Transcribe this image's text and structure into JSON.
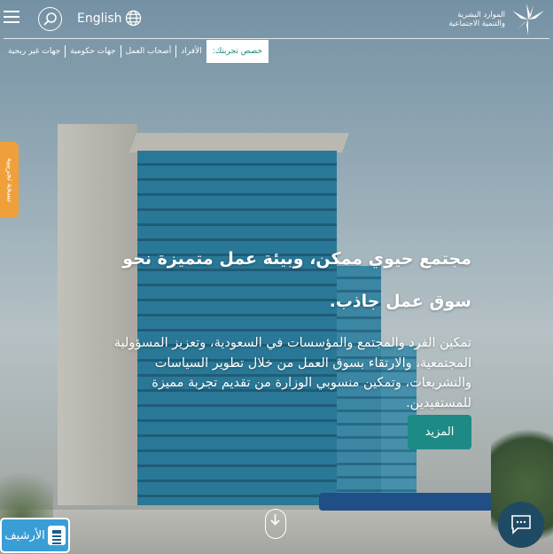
{
  "header": {
    "language_label": "English",
    "logo_text_line1": "الموارد البشرية",
    "logo_text_line2": "والتنمية الاجتماعية"
  },
  "nav": {
    "active_label": "خصص تجربتك:",
    "items": [
      "الأفراد",
      "أصحاب العمل",
      "جهات حكومية",
      "جهات غير ربحية"
    ]
  },
  "beta_tab": "نسخة تجريبية",
  "hero": {
    "title": "مجتمع حيوي ممكن، وبيئة عمل متميزة نحو سوق عمل جاذب.",
    "description": "تمكين الفرد والمجتمع والمؤسسات في السعودية، وتعزيز المسؤولية المجتمعية، والارتقاء بسوق العمل من خلال تطوير السياسات والتشريعات، وتمكين منسوبي الوزارة من تقديم تجربة مميزة للمستفيدين.",
    "more_button": "المزيد"
  },
  "archive_badge": "الأرشيف",
  "colors": {
    "accent": "#1e8a86",
    "beta": "#f0a03a",
    "chat": "#1f4a64",
    "archive": "#3a9ed6"
  },
  "icons": [
    "menu-icon",
    "search-icon",
    "globe-icon",
    "logo-icon",
    "scroll-down-icon",
    "chat-icon",
    "archive-icon"
  ]
}
